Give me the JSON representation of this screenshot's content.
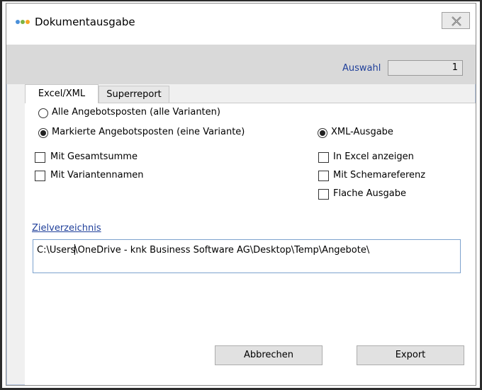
{
  "window": {
    "title": "Dokumentausgabe",
    "app_icon": "dots-icon",
    "close_icon": "close-x-icon"
  },
  "header": {
    "auswahl_label": "Auswahl",
    "auswahl_value": "1"
  },
  "tabs": [
    {
      "label": "Excel/XML",
      "active": true
    },
    {
      "label": "Superreport",
      "active": false
    }
  ],
  "options": {
    "radio_all": {
      "label": "Alle Angebotsposten (alle Varianten)",
      "selected": false
    },
    "radio_marked": {
      "label": "Markierte Angebotsposten (eine Variante)",
      "selected": true
    },
    "radio_xml": {
      "label": "XML-Ausgabe",
      "selected": true
    },
    "check_gesamtsumme": {
      "label": "Mit Gesamtsumme",
      "checked": false
    },
    "check_variantennamen": {
      "label": "Mit Variantennamen",
      "checked": false
    },
    "check_excel": {
      "label": "In Excel anzeigen",
      "checked": false
    },
    "check_schema": {
      "label": "Mit Schemareferenz",
      "checked": false
    },
    "check_flache": {
      "label": "Flache Ausgabe",
      "checked": false
    }
  },
  "target": {
    "link_label": "Zielverzeichnis",
    "path_part1": "C:\\Users",
    "path_part2": "\\OneDrive - knk Business Software AG\\Desktop\\Temp\\Angebote\\"
  },
  "buttons": {
    "cancel": "Abbrechen",
    "export": "Export"
  },
  "colors": {
    "link": "#1f3f9a",
    "dot_blue": "#4a90d9",
    "dot_green": "#7cb342",
    "dot_orange": "#f5a623"
  }
}
